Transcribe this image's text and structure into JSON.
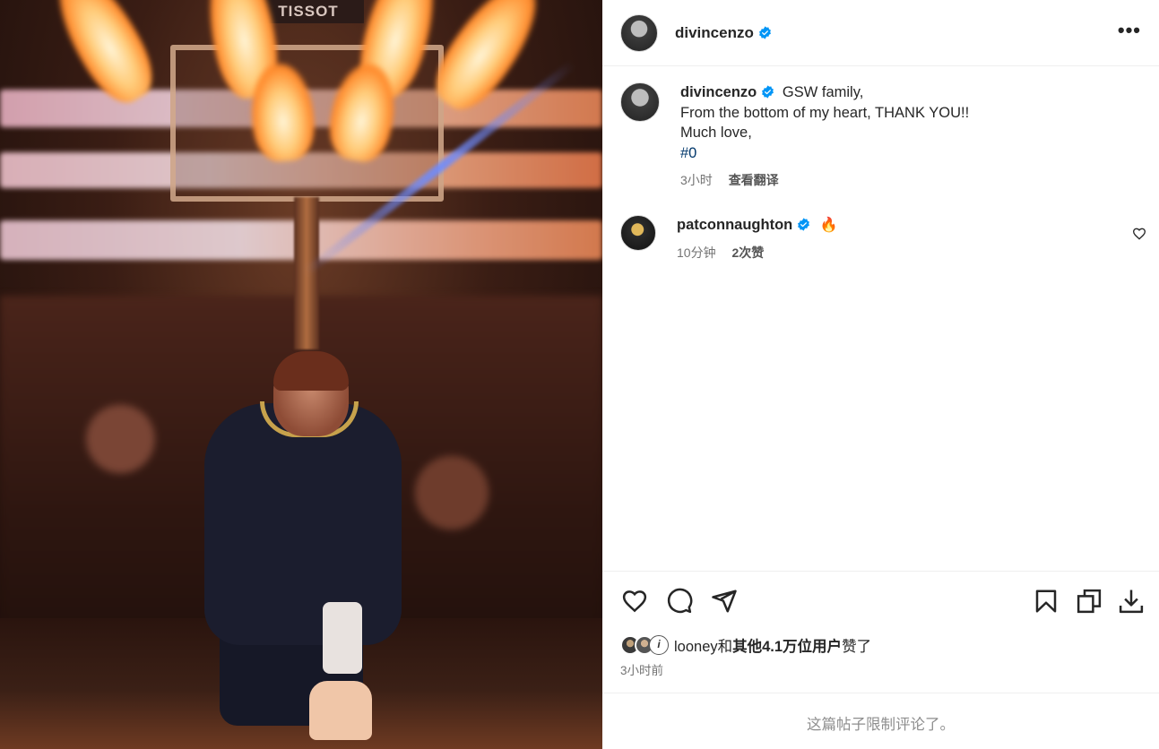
{
  "photo": {
    "brand_sign": "TISSOT"
  },
  "post": {
    "author": "divincenzo",
    "more_icon": "more-horizontal-icon",
    "caption": {
      "text_line1": "GSW family,",
      "text_line2": "From the bottom of my heart, THANK YOU!!",
      "text_line3": "Much love,",
      "hashtag": "#0",
      "time": "3小时",
      "translate": "查看翻译"
    },
    "comments": [
      {
        "author": "patconnaughton",
        "text": "🔥",
        "time": "10分钟",
        "likes": "2次赞"
      }
    ],
    "actions": {
      "like_icon": "heart-icon",
      "comment_icon": "comment-icon",
      "share_icon": "send-icon",
      "save_icon": "bookmark-icon",
      "copy_icon": "copy-icon",
      "download_icon": "download-icon"
    },
    "liked_by": {
      "user": "looney",
      "connector": "和",
      "others": "其他4.1万位用户",
      "suffix": "赞了",
      "avatar_c_glyph": "i"
    },
    "posted_time": "3小时前",
    "comments_limited": "这篇帖子限制评论了。"
  },
  "colors": {
    "verified": "#0095f6",
    "text_primary": "#262626",
    "text_secondary": "#737373",
    "hashtag": "#00376b"
  }
}
